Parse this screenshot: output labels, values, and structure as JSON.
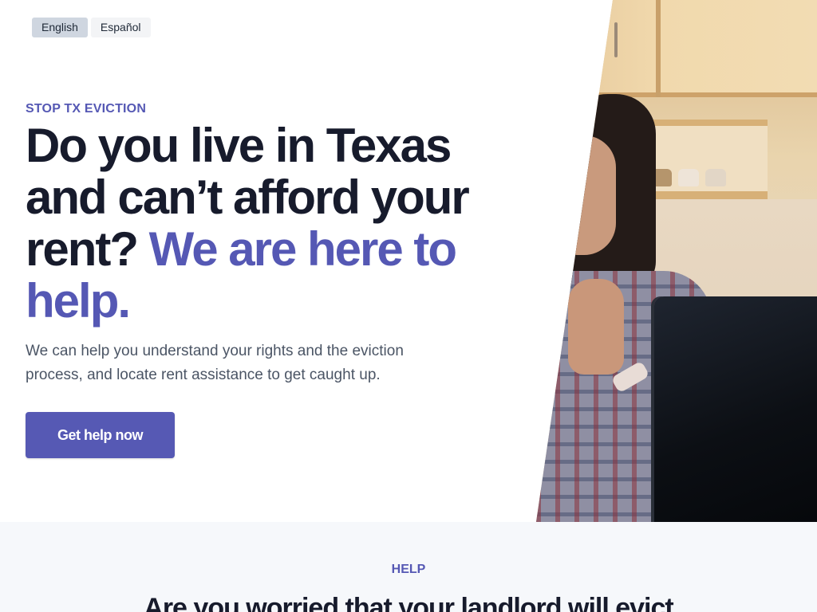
{
  "language_switcher": {
    "options": [
      "English",
      "Español"
    ],
    "selected": "English"
  },
  "hero": {
    "eyebrow": "STOP TX EVICTION",
    "headline_main": "Do you live in Texas and can’t afford your rent?",
    "headline_accent": "We are here to help.",
    "subtext": "We can help you understand your rights and the eviction process, and locate rent assistance to get caught up.",
    "cta_label": "Get help now",
    "image_alt": "woman-at-laptop-photo"
  },
  "help_section": {
    "label": "HELP",
    "title": "Are you worried that your landlord will evict"
  },
  "colors": {
    "accent": "#5558b4",
    "heading": "#171b2c",
    "body_text": "#4b5565",
    "section_bg": "#f6f8fb"
  }
}
